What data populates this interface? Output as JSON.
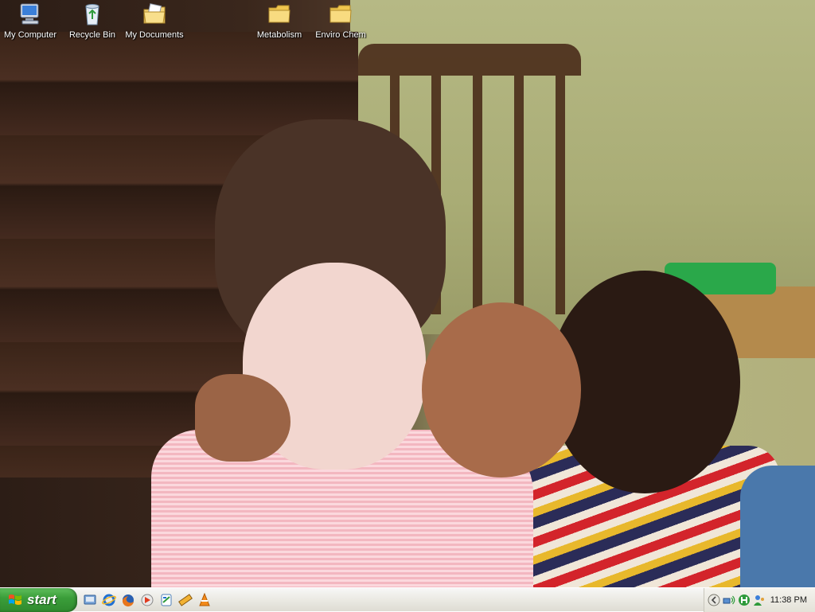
{
  "desktop": {
    "icons": [
      {
        "label": "My Computer",
        "icon": "my-computer-icon"
      },
      {
        "label": "Recycle Bin",
        "icon": "recycle-bin-icon"
      },
      {
        "label": "My Documents",
        "icon": "my-documents-icon"
      },
      {
        "label": "Metabolism",
        "icon": "folder-icon"
      },
      {
        "label": "Enviro Chem",
        "icon": "folder-icon"
      }
    ]
  },
  "taskbar": {
    "start_label": "start",
    "quick_launch": [
      {
        "icon": "show-desktop-icon"
      },
      {
        "icon": "internet-explorer-icon"
      },
      {
        "icon": "firefox-icon"
      },
      {
        "icon": "media-player-icon"
      },
      {
        "icon": "messenger-icon"
      },
      {
        "icon": "ruler-tool-icon"
      },
      {
        "icon": "vlc-icon"
      }
    ],
    "tray": {
      "icons": [
        "collapse-arrow-icon",
        "network-icon",
        "antivirus-icon",
        "user-icon"
      ],
      "clock": "11:38 PM"
    }
  },
  "colors": {
    "start_green": "#3b9e3a",
    "taskbar_bg": "#ecebe5",
    "icon_label": "#ffffff"
  }
}
